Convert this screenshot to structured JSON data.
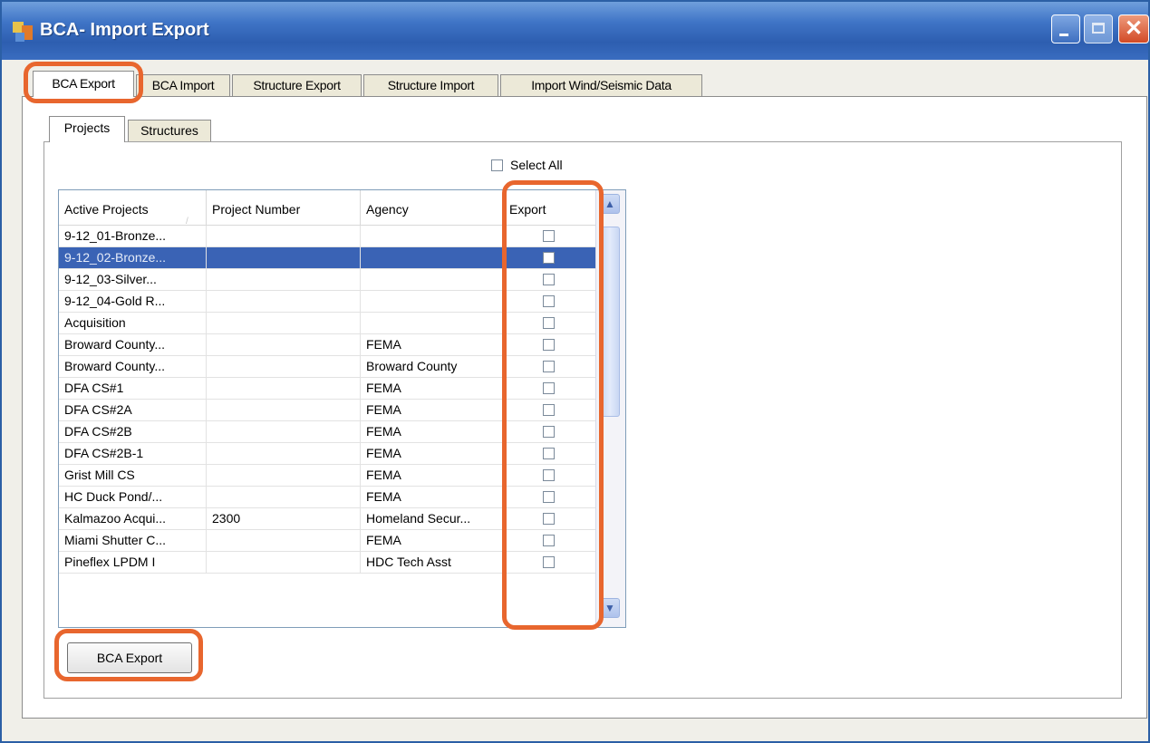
{
  "window": {
    "title": "BCA- Import Export"
  },
  "outer_tabs": [
    {
      "label": "BCA Export"
    },
    {
      "label": "BCA Import"
    },
    {
      "label": "Structure Export"
    },
    {
      "label": "Structure Import"
    },
    {
      "label": "Import Wind/Seismic Data"
    }
  ],
  "inner_tabs": [
    {
      "label": "Projects"
    },
    {
      "label": "Structures"
    }
  ],
  "select_all": {
    "label": "Select All"
  },
  "grid": {
    "columns": [
      "Active Projects",
      "Project Number",
      "Agency",
      "Export"
    ],
    "rows": [
      {
        "name": "9-12_01-Bronze...",
        "number": "",
        "agency": ""
      },
      {
        "name": "9-12_02-Bronze...",
        "number": "",
        "agency": ""
      },
      {
        "name": "9-12_03-Silver...",
        "number": "",
        "agency": ""
      },
      {
        "name": "9-12_04-Gold R...",
        "number": "",
        "agency": ""
      },
      {
        "name": "Acquisition",
        "number": "",
        "agency": ""
      },
      {
        "name": "Broward County...",
        "number": "",
        "agency": "FEMA"
      },
      {
        "name": "Broward County...",
        "number": "",
        "agency": "Broward County"
      },
      {
        "name": "DFA CS#1",
        "number": "",
        "agency": "FEMA"
      },
      {
        "name": "DFA CS#2A",
        "number": "",
        "agency": "FEMA"
      },
      {
        "name": "DFA CS#2B",
        "number": "",
        "agency": "FEMA"
      },
      {
        "name": "DFA CS#2B-1",
        "number": "",
        "agency": "FEMA"
      },
      {
        "name": "Grist Mill CS",
        "number": "",
        "agency": "FEMA"
      },
      {
        "name": "HC Duck Pond/...",
        "number": "",
        "agency": "FEMA"
      },
      {
        "name": "Kalmazoo Acqui...",
        "number": "2300",
        "agency": "Homeland Secur..."
      },
      {
        "name": "Miami Shutter C...",
        "number": "",
        "agency": "FEMA"
      },
      {
        "name": "Pineflex LPDM I",
        "number": "",
        "agency": "HDC Tech Asst"
      }
    ]
  },
  "export_button": {
    "label": "BCA Export"
  },
  "colors": {
    "highlight": "#e8662e",
    "titlebar": "#3f74c6",
    "selected_row": "#3a63b5"
  }
}
